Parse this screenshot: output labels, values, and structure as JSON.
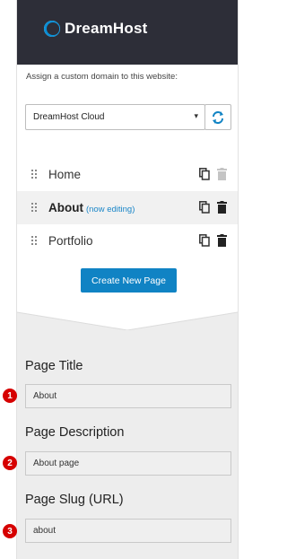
{
  "header": {
    "brand": "DreamHost"
  },
  "domain": {
    "assign_text": "Assign a custom domain to this website:",
    "selected": "DreamHost Cloud"
  },
  "pages": [
    {
      "label": "Home",
      "active": false,
      "note": ""
    },
    {
      "label": "About",
      "active": true,
      "note": "(now editing)"
    },
    {
      "label": "Portfolio",
      "active": false,
      "note": ""
    }
  ],
  "create_button": "Create New Page",
  "form": {
    "title_label": "Page Title",
    "title_value": "About",
    "description_label": "Page Description",
    "description_value": "About page",
    "slug_label": "Page Slug (URL)",
    "slug_value": "about"
  },
  "markers": [
    "1",
    "2",
    "3"
  ],
  "colors": {
    "header": "#2d2e38",
    "accent": "#1083c4",
    "marker": "#d60000"
  }
}
